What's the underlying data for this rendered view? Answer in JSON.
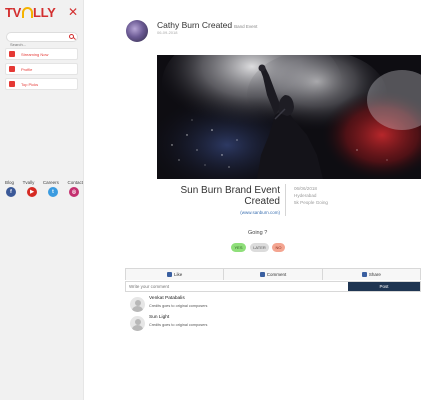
{
  "brand": {
    "logo_prefix": "TV",
    "logo_suffix": "LLY",
    "accent": "#d32f2f"
  },
  "sidebar": {
    "close_glyph": "✕",
    "search_placeholder": "Search...",
    "items": [
      {
        "label": "Streaming Now",
        "icon": "broadcast-icon"
      },
      {
        "label": "Profile",
        "icon": "user-icon"
      },
      {
        "label": "Top Picks",
        "icon": "star-icon"
      }
    ],
    "footer_links": [
      "Blog",
      "Tvally",
      "Careers",
      "Contact"
    ],
    "social": [
      {
        "name": "facebook-icon",
        "glyph": "f",
        "color": "#3b5998"
      },
      {
        "name": "youtube-icon",
        "glyph": "▶",
        "color": "#d62b24"
      },
      {
        "name": "twitter-icon",
        "glyph": "t",
        "color": "#3a9be0"
      },
      {
        "name": "instagram-icon",
        "glyph": "◎",
        "color": "#c4306f"
      }
    ]
  },
  "post": {
    "author_title": "Cathy Burn Created",
    "tag": "Band Event",
    "timestamp": "06-09-2018"
  },
  "event": {
    "title": "Sun Burn Brand Event Created",
    "link": "(www.sanburn.com)",
    "date": "06/06/2018",
    "location": "Hyderabad",
    "going_count": "5k People Going"
  },
  "rsvp": {
    "question": "Going ?",
    "yes": "YES",
    "later": "LATER",
    "no": "NO"
  },
  "actions": {
    "like": "Like",
    "comment": "Comment",
    "share": "Share"
  },
  "comment_box": {
    "placeholder": "Write your comment",
    "post_label": "Post"
  },
  "comments": [
    {
      "name": "Venkat Patabalis",
      "text": "Credits goes to original composers"
    },
    {
      "name": "Sun Light",
      "text": "Credits goes to original composers"
    }
  ]
}
